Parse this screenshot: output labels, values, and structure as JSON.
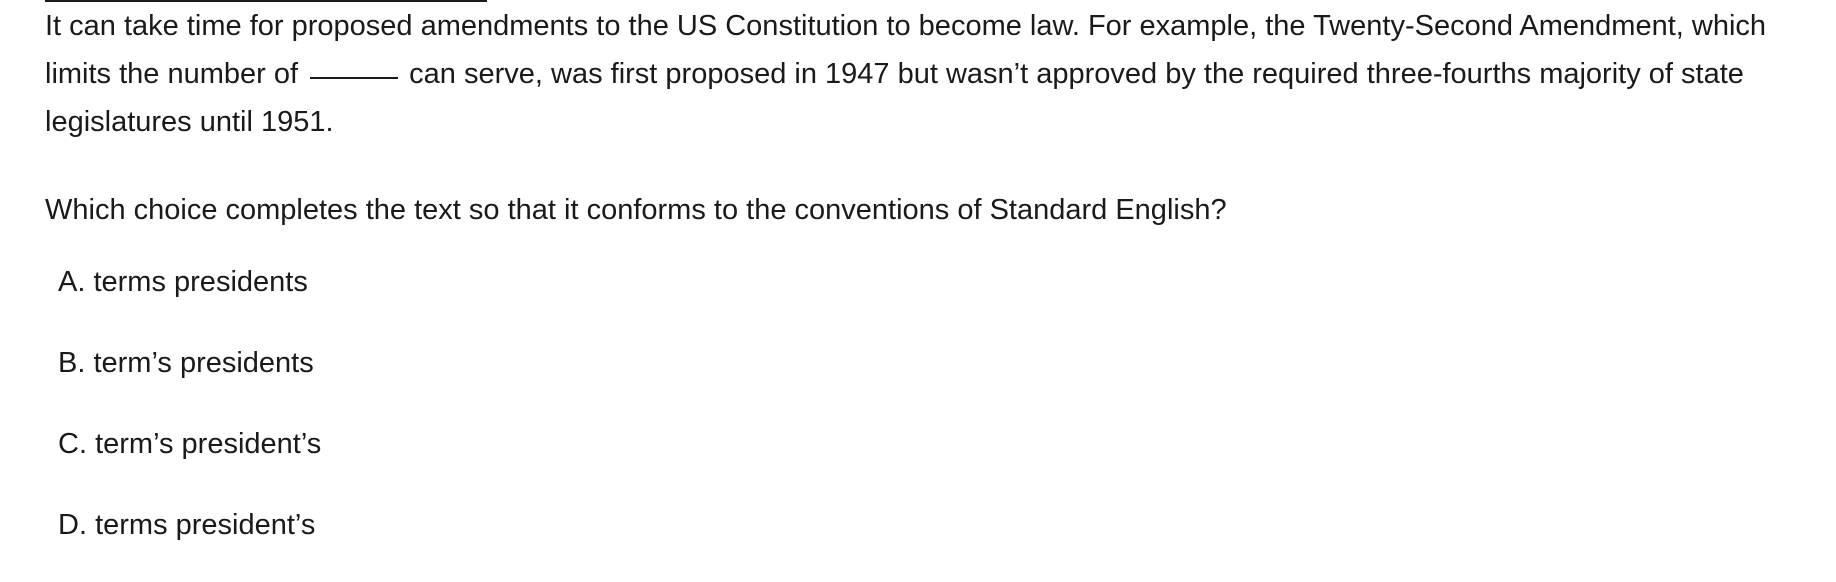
{
  "passage": {
    "text_before": "It can take time for proposed amendments to the US Constitution to become law. For example, the Twenty-Second Amendment, which limits the number of",
    "text_after": "can serve, was first proposed in 1947 but wasn’t approved by the required three-fourths majority of state legislatures until 1951."
  },
  "question": {
    "prompt": "Which choice completes the text so that it conforms to the conventions of Standard English?"
  },
  "choices": [
    {
      "letter": "A.",
      "text": "terms presidents"
    },
    {
      "letter": "B.",
      "text": "term’s presidents"
    },
    {
      "letter": "C.",
      "text": "term’s president’s"
    },
    {
      "letter": "D.",
      "text": "terms president’s"
    }
  ]
}
